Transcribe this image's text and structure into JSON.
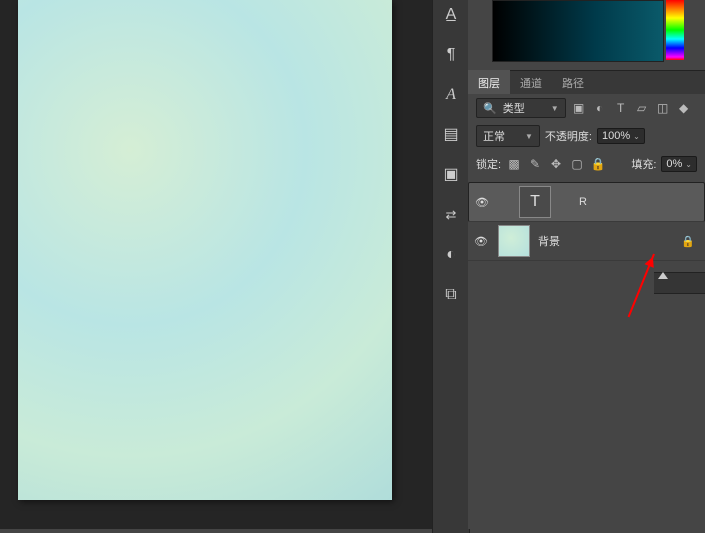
{
  "tabs": {
    "layers": "图层",
    "channels": "通道",
    "paths": "路径"
  },
  "filter": {
    "label": "类型"
  },
  "blend": {
    "mode": "正常"
  },
  "opacity": {
    "label": "不透明度:",
    "value": "100%"
  },
  "lock": {
    "label": "锁定:"
  },
  "fill": {
    "label": "填充:",
    "value": "0%"
  },
  "layer1": {
    "name": "R"
  },
  "layer2": {
    "name": "背景"
  }
}
